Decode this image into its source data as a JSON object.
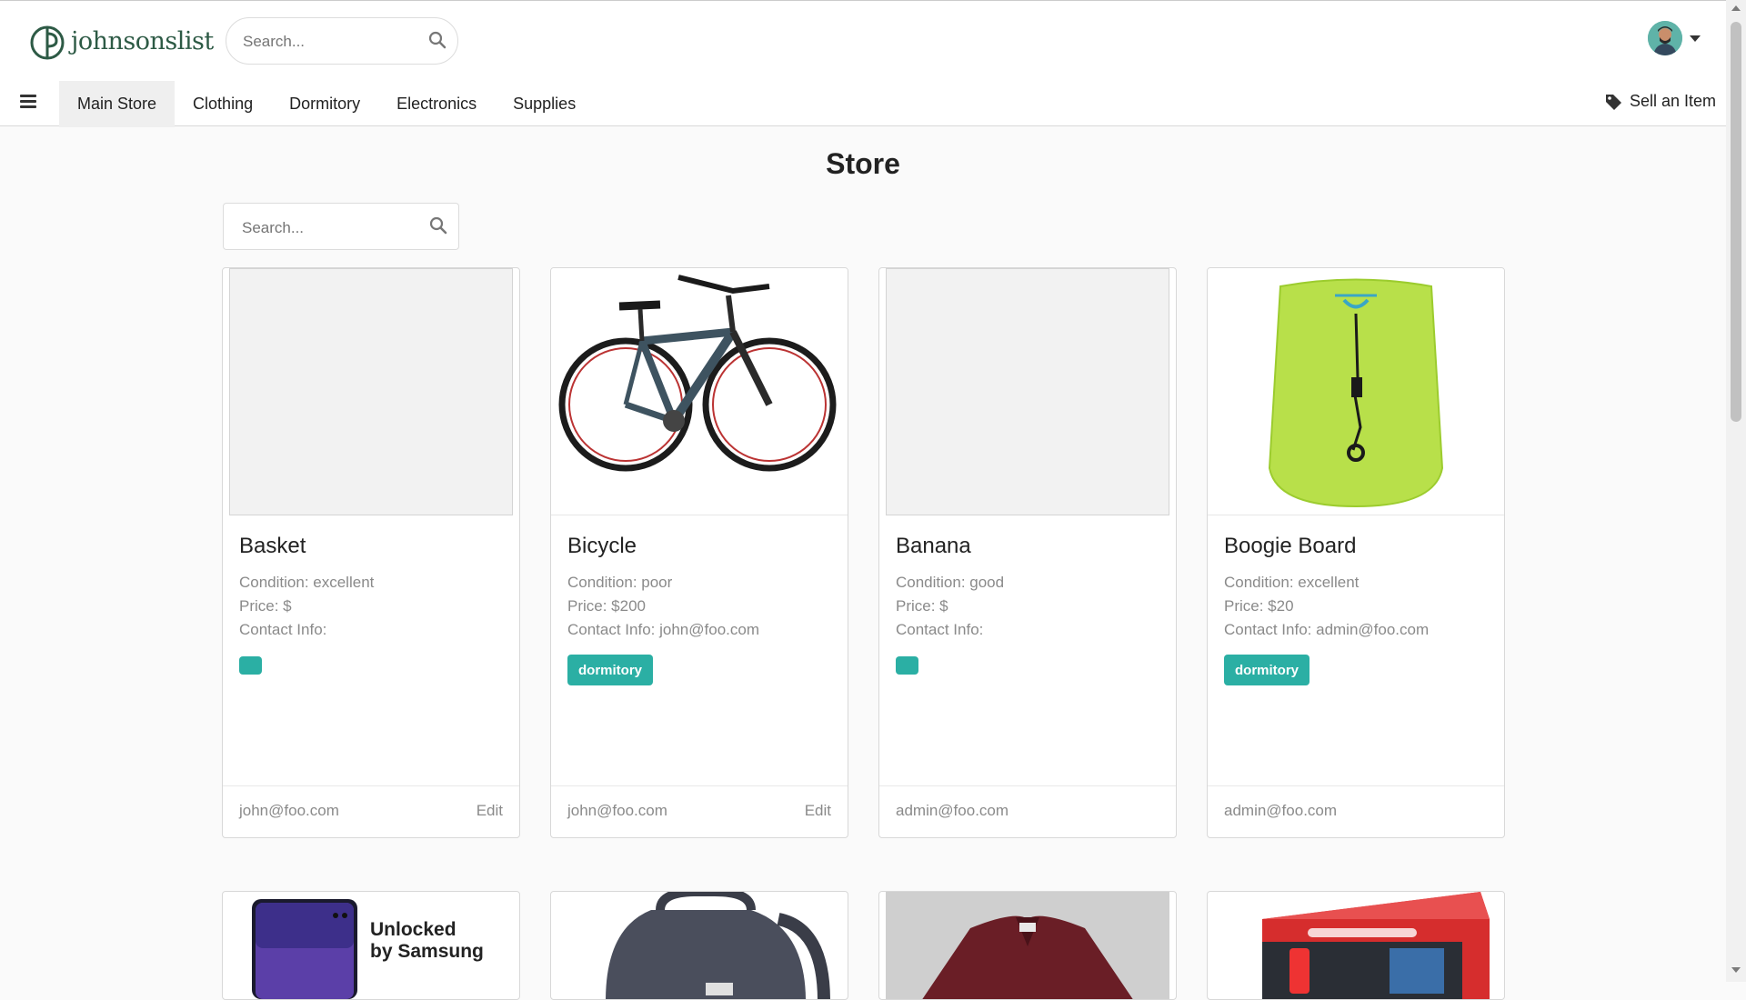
{
  "app": {
    "logo_text": "johnsonslist"
  },
  "header": {
    "search_placeholder": "Search...",
    "sell_label": "Sell an Item"
  },
  "nav": {
    "items": [
      {
        "label": "Main Store",
        "active": true
      },
      {
        "label": "Clothing"
      },
      {
        "label": "Dormitory"
      },
      {
        "label": "Electronics"
      },
      {
        "label": "Supplies"
      }
    ]
  },
  "main": {
    "title": "Store",
    "search_placeholder": "Search..."
  },
  "cards": [
    {
      "title": "Basket",
      "condition": "Condition: excellent",
      "price": "Price: $",
      "contact": "Contact Info:",
      "tag": "",
      "email": "john@foo.com",
      "edit": "Edit"
    },
    {
      "title": "Bicycle",
      "condition": "Condition: poor",
      "price": "Price: $200",
      "contact": "Contact Info: john@foo.com",
      "tag": "dormitory",
      "email": "john@foo.com",
      "edit": "Edit"
    },
    {
      "title": "Banana",
      "condition": "Condition: good",
      "price": "Price: $",
      "contact": "Contact Info:",
      "tag": "",
      "email": "admin@foo.com",
      "edit": ""
    },
    {
      "title": "Boogie Board",
      "condition": "Condition: excellent",
      "price": "Price: $20",
      "contact": "Contact Info: admin@foo.com",
      "tag": "dormitory",
      "email": "admin@foo.com",
      "edit": ""
    }
  ],
  "second_row": {
    "phone_text_1": "Unlocked",
    "phone_text_2": "by Samsung"
  },
  "colors": {
    "accent": "#2bafa4",
    "brand": "#2d5a45"
  }
}
